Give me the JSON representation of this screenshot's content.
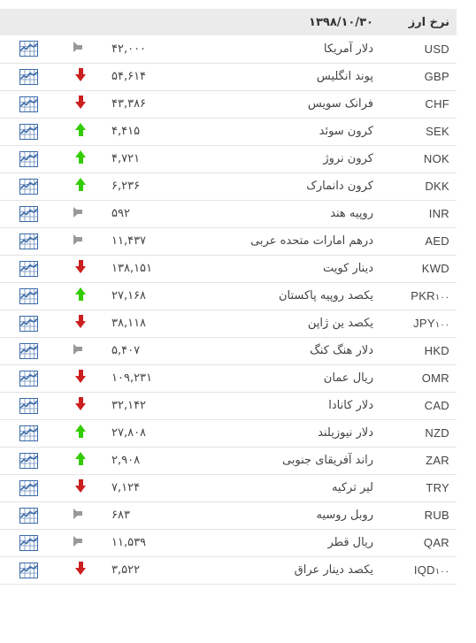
{
  "page": {
    "direction": "rtl",
    "title": "نرخ ارز"
  },
  "table": {
    "header": {
      "currency_label": "نرخ ارز",
      "date_label": "۱۳۹۸/۱۰/۳۰",
      "value_label": "",
      "arrow_label": "",
      "chart_label": "",
      "rss_label": ""
    },
    "colors": {
      "header_bg": "#ebebeb",
      "row_border": "#e4e4e4",
      "text": "#444444",
      "up": "#33cc00",
      "down": "#cc1f1f",
      "flat": "#999999",
      "rss_orange": "#f08a24",
      "chart_blue": "#3b6aa8"
    },
    "icon_names": {
      "rss": "rss-feed-icon",
      "chart": "chart-icon",
      "up": "arrow-up-icon",
      "down": "arrow-down-icon",
      "flat": "arrow-flat-icon"
    },
    "rows": [
      {
        "code": "USD",
        "mult": "",
        "name": "دلار آمریکا",
        "value": "۴۲,۰۰۰",
        "trend": "flat"
      },
      {
        "code": "GBP",
        "mult": "",
        "name": "پوند انگلیس",
        "value": "۵۴,۶۱۴",
        "trend": "down"
      },
      {
        "code": "CHF",
        "mult": "",
        "name": "فرانک سویس",
        "value": "۴۳,۳۸۶",
        "trend": "down"
      },
      {
        "code": "SEK",
        "mult": "",
        "name": "کرون سوئد",
        "value": "۴,۴۱۵",
        "trend": "up"
      },
      {
        "code": "NOK",
        "mult": "",
        "name": "کرون نروژ",
        "value": "۴,۷۲۱",
        "trend": "up"
      },
      {
        "code": "DKK",
        "mult": "",
        "name": "کرون دانمارک",
        "value": "۶,۲۳۶",
        "trend": "up"
      },
      {
        "code": "INR",
        "mult": "",
        "name": "روپیه هند",
        "value": "۵۹۲",
        "trend": "flat"
      },
      {
        "code": "AED",
        "mult": "",
        "name": "درهم امارات متحده عربی",
        "value": "۱۱,۴۳۷",
        "trend": "flat"
      },
      {
        "code": "KWD",
        "mult": "",
        "name": "دینار کویت",
        "value": "۱۳۸,۱۵۱",
        "trend": "down"
      },
      {
        "code": "PKR",
        "mult": "۱۰۰",
        "name": "یکصد روپیه پاکستان",
        "value": "۲۷,۱۶۸",
        "trend": "up"
      },
      {
        "code": "JPY",
        "mult": "۱۰۰",
        "name": "یکصد ین ژاپن",
        "value": "۳۸,۱۱۸",
        "trend": "down"
      },
      {
        "code": "HKD",
        "mult": "",
        "name": "دلار هنگ کنگ",
        "value": "۵,۴۰۷",
        "trend": "flat"
      },
      {
        "code": "OMR",
        "mult": "",
        "name": "ریال عمان",
        "value": "۱۰۹,۲۳۱",
        "trend": "down"
      },
      {
        "code": "CAD",
        "mult": "",
        "name": "دلار کانادا",
        "value": "۳۲,۱۴۲",
        "trend": "down"
      },
      {
        "code": "NZD",
        "mult": "",
        "name": "دلار نیوزیلند",
        "value": "۲۷,۸۰۸",
        "trend": "up"
      },
      {
        "code": "ZAR",
        "mult": "",
        "name": "راند آفریقای جنوبی",
        "value": "۲,۹۰۸",
        "trend": "up"
      },
      {
        "code": "TRY",
        "mult": "",
        "name": "لیر ترکیه",
        "value": "۷,۱۲۴",
        "trend": "down"
      },
      {
        "code": "RUB",
        "mult": "",
        "name": "روبل روسیه",
        "value": "۶۸۳",
        "trend": "flat"
      },
      {
        "code": "QAR",
        "mult": "",
        "name": "ریال قطر",
        "value": "۱۱,۵۳۹",
        "trend": "flat"
      },
      {
        "code": "IQD",
        "mult": "۱۰۰",
        "name": "یکصد دینار عراق",
        "value": "۳,۵۲۲",
        "trend": "down"
      }
    ]
  }
}
